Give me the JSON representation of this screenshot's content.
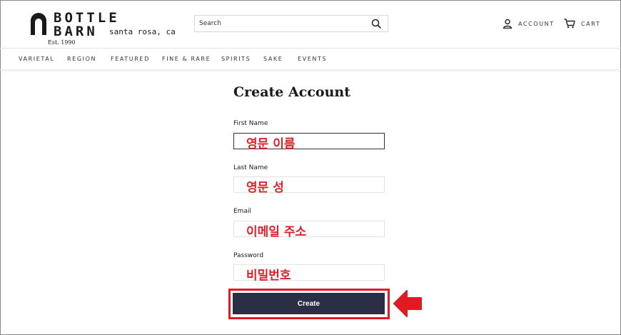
{
  "header": {
    "brand_line1": "BOTTLE",
    "brand_line2": "BARN",
    "brand_city": "santa rosa, ca",
    "brand_est": "Est. 1990",
    "search_placeholder": "Search",
    "account_label": "ACCOUNT",
    "cart_label": "CART"
  },
  "nav": {
    "items": [
      "VARIETAL",
      "REGION",
      "FEATURED",
      "FINE & RARE",
      "SPIRITS",
      "SAKE",
      "EVENTS"
    ]
  },
  "form": {
    "title": "Create Account",
    "fields": [
      {
        "label": "First Name",
        "annotation": "영문 이름"
      },
      {
        "label": "Last Name",
        "annotation": "영문 성"
      },
      {
        "label": "Email",
        "annotation": "이메일 주소"
      },
      {
        "label": "Password",
        "annotation": "비밀번호"
      }
    ],
    "submit_label": "Create"
  },
  "colors": {
    "accent_red": "#e11a24",
    "button_navy": "#2a2f45"
  },
  "icons": [
    "brand-logo-icon",
    "search-icon",
    "account-icon",
    "cart-icon",
    "arrow-left-icon"
  ]
}
